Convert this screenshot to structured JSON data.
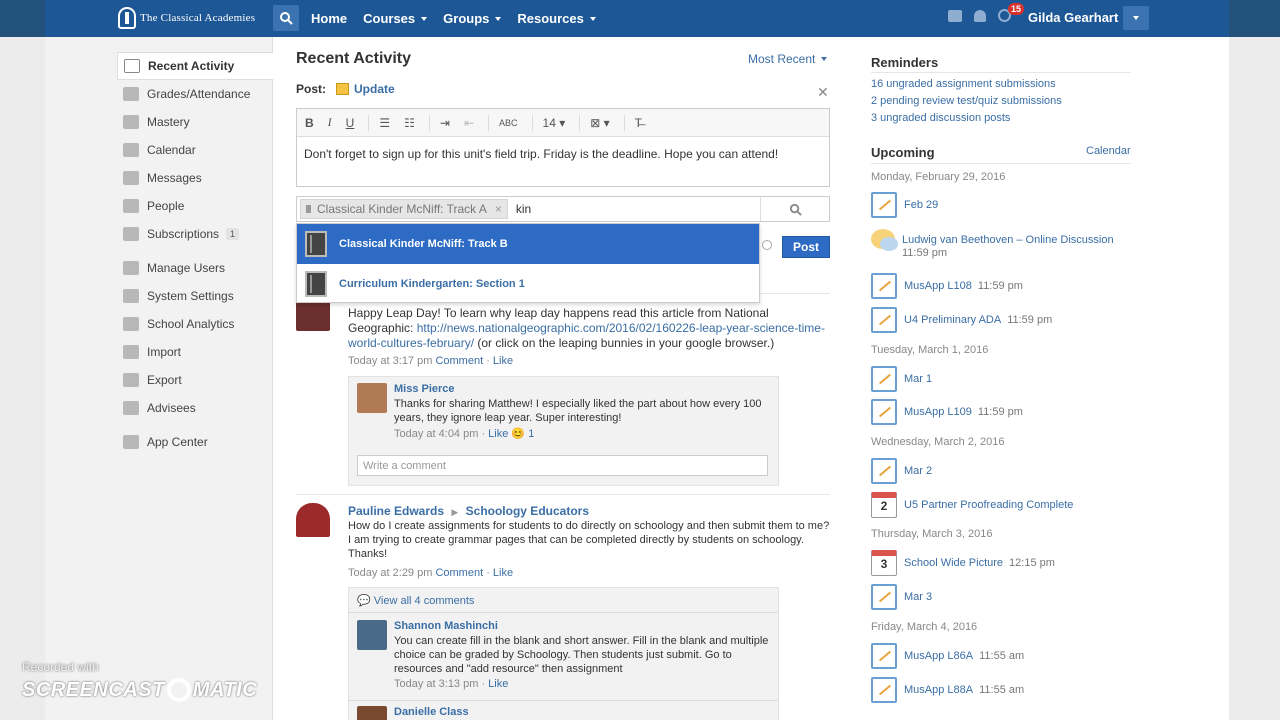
{
  "topbar": {
    "logo_text": "The Classical Academies",
    "nav": [
      {
        "label": "Home",
        "has_caret": false
      },
      {
        "label": "Courses",
        "has_caret": true
      },
      {
        "label": "Groups",
        "has_caret": true
      },
      {
        "label": "Resources",
        "has_caret": true
      }
    ],
    "notification_count": "15",
    "username": "Gilda Gearhart"
  },
  "sidebar": {
    "items": [
      {
        "label": "Recent Activity",
        "icon": "activity-icon"
      },
      {
        "label": "Grades/Attendance",
        "icon": "grades-icon"
      },
      {
        "label": "Mastery",
        "icon": "mastery-icon"
      },
      {
        "label": "Calendar",
        "icon": "calendar-icon"
      },
      {
        "label": "Messages",
        "icon": "messages-icon"
      },
      {
        "label": "People",
        "icon": "people-icon"
      },
      {
        "label": "Subscriptions",
        "icon": "subscriptions-icon",
        "badge": "1"
      },
      {
        "label": "Manage Users",
        "icon": "manage-users-icon"
      },
      {
        "label": "System Settings",
        "icon": "settings-icon"
      },
      {
        "label": "School Analytics",
        "icon": "analytics-icon"
      },
      {
        "label": "Import",
        "icon": "import-icon"
      },
      {
        "label": "Export",
        "icon": "export-icon"
      },
      {
        "label": "Advisees",
        "icon": "advisees-icon"
      },
      {
        "label": "App Center",
        "icon": "app-center-icon"
      }
    ]
  },
  "main": {
    "title": "Recent Activity",
    "sort_label": "Most Recent",
    "post_label": "Post:",
    "post_type": "Update",
    "toolbar": {
      "font_size": "14"
    },
    "editor_text": "Don't forget to sign up for this unit's field trip. Friday is the deadline. Hope you can attend!",
    "recipient_chip": "Classical Kinder McNiff: Track A",
    "recipient_input": "kin",
    "suggestions": [
      "Classical Kinder McNiff: Track B",
      "Curriculum Kindergarten: Section 1"
    ],
    "post_button": "Post",
    "posts": [
      {
        "body_before_link": "Happy Leap Day! To learn why leap day happens read this article from National Geographic: ",
        "link": "http://news.nationalgeographic.com/2016/02/160226-leap-year-science-time-world-cultures-february/",
        "body_after_link": " (or click on the leaping bunnies in your google browser.)",
        "time": "Today at 3:17 pm",
        "comment_label": "Comment",
        "like_label": "Like",
        "comments": [
          {
            "author": "Miss Pierce",
            "text": "Thanks for sharing Matthew! I especially liked the part about how every 100 years, they ignore leap year. Super interesting!",
            "time": "Today at 4:04 pm",
            "like_label": "Like",
            "like_count": "1"
          }
        ],
        "write_placeholder": "Write a comment"
      },
      {
        "author": "Pauline Edwards",
        "group": "Schoology Educators",
        "body": "How do I create assignments for students to do directly on schoology and then submit them to me?  I am trying to create grammar pages that can be completed directly by students on schoology.  Thanks!",
        "time": "Today at 2:29 pm",
        "comment_label": "Comment",
        "like_label": "Like",
        "view_all": "View all 4 comments",
        "comments": [
          {
            "author": "Shannon Mashinchi",
            "text": "You can create fill in the blank and short answer. Fill in the blank and multiple choice can be graded by Schoology. Then students just submit. Go to resources and \"add resource\" then assignment",
            "time": "Today at 3:13 pm",
            "like_label": "Like"
          },
          {
            "author": "Danielle Class"
          }
        ]
      }
    ]
  },
  "reminders": {
    "title": "Reminders",
    "items": [
      "16 ungraded assignment submissions",
      "2 pending review test/quiz submissions",
      "3 ungraded discussion posts"
    ]
  },
  "upcoming": {
    "title": "Upcoming",
    "calendar_link": "Calendar",
    "days": [
      {
        "date": "Monday, February 29, 2016",
        "events": [
          {
            "title": "Feb 29",
            "time": "",
            "icon": "assignment"
          },
          {
            "title": "Ludwig van Beethoven – Online Discussion",
            "time": "11:59 pm",
            "icon": "discussion"
          },
          {
            "title": "MusApp L108",
            "time": "11:59 pm",
            "icon": "assignment"
          },
          {
            "title": "U4 Preliminary ADA",
            "time": "11:59 pm",
            "icon": "assignment"
          }
        ]
      },
      {
        "date": "Tuesday, March 1, 2016",
        "events": [
          {
            "title": "Mar 1",
            "time": "",
            "icon": "assignment"
          },
          {
            "title": "MusApp L109",
            "time": "11:59 pm",
            "icon": "assignment"
          }
        ]
      },
      {
        "date": "Wednesday, March 2, 2016",
        "events": [
          {
            "title": "Mar 2",
            "time": "",
            "icon": "assignment"
          },
          {
            "title": "U5 Partner Proofreading Complete",
            "time": "",
            "icon": "calendar",
            "day_num": "2"
          }
        ]
      },
      {
        "date": "Thursday, March 3, 2016",
        "events": [
          {
            "title": "School Wide Picture",
            "time": "12:15 pm",
            "icon": "calendar",
            "day_num": "3"
          },
          {
            "title": "Mar 3",
            "time": "",
            "icon": "assignment"
          }
        ]
      },
      {
        "date": "Friday, March 4, 2016",
        "events": [
          {
            "title": "MusApp L86A",
            "time": "11:55 am",
            "icon": "assignment"
          },
          {
            "title": "MusApp L88A",
            "time": "11:55 am",
            "icon": "assignment"
          }
        ]
      }
    ]
  },
  "watermark": {
    "small": "Recorded with",
    "big_left": "SCREENCAST",
    "big_right": "MATIC"
  }
}
